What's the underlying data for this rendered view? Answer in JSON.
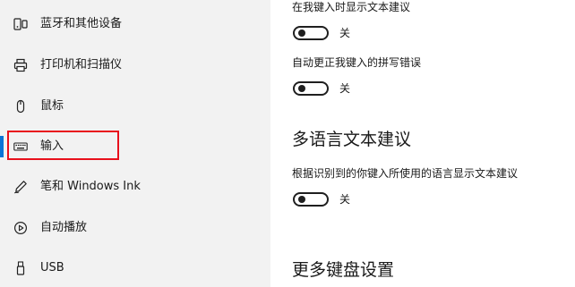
{
  "sidebar": {
    "items": [
      {
        "label": "蓝牙和其他设备",
        "icon": "bluetooth-devices-icon"
      },
      {
        "label": "打印机和扫描仪",
        "icon": "printer-icon"
      },
      {
        "label": "鼠标",
        "icon": "mouse-icon"
      },
      {
        "label": "输入",
        "icon": "keyboard-icon",
        "selected": true
      },
      {
        "label": "笔和 Windows Ink",
        "icon": "pen-icon"
      },
      {
        "label": "自动播放",
        "icon": "autoplay-icon"
      },
      {
        "label": "USB",
        "icon": "usb-icon"
      }
    ]
  },
  "content": {
    "settings": [
      {
        "label": "在我键入时显示文本建议",
        "state": "关",
        "on": false
      },
      {
        "label": "自动更正我键入的拼写错误",
        "state": "关",
        "on": false
      }
    ],
    "multilingual": {
      "title": "多语言文本建议",
      "settings": [
        {
          "label": "根据识别到的你键入所使用的语言显示文本建议",
          "state": "关",
          "on": false
        }
      ]
    },
    "more_keyboard": {
      "title": "更多键盘设置"
    }
  },
  "colors": {
    "accent": "#0a74d6",
    "highlight": "#e8101c",
    "sidebar_bg": "#f2f2f2"
  }
}
